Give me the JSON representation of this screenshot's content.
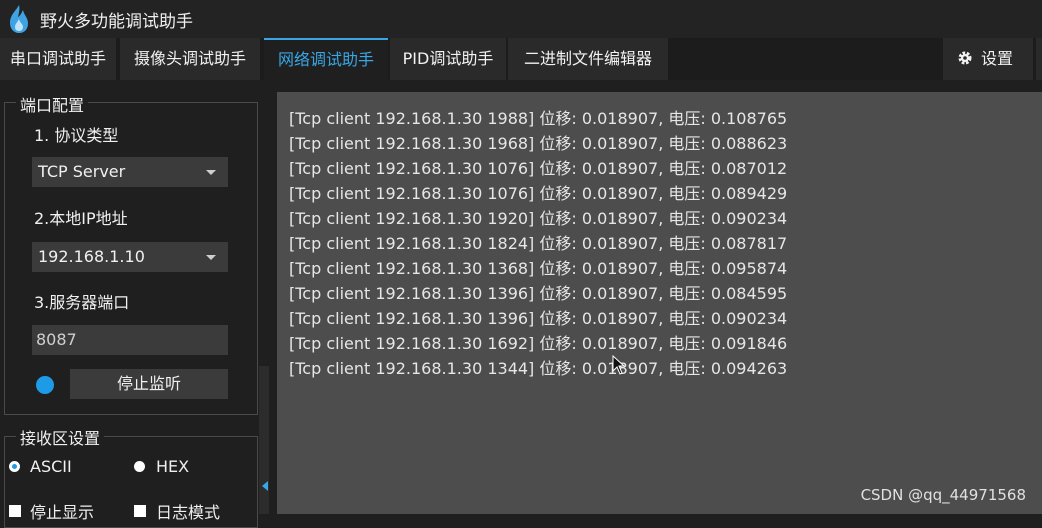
{
  "app": {
    "title": "野火多功能调试助手"
  },
  "tabs": [
    {
      "label": "串口调试助手"
    },
    {
      "label": "摄像头调试助手"
    },
    {
      "label": "网络调试助手",
      "active": true
    },
    {
      "label": "PID调试助手"
    },
    {
      "label": "二进制文件编辑器"
    }
  ],
  "settings": {
    "label": "设置"
  },
  "port_config": {
    "title": "端口配置",
    "protocol_label": "1. 协议类型",
    "protocol_value": "TCP Server",
    "local_ip_label": "2.本地IP地址",
    "local_ip_value": "192.168.1.10",
    "server_port_label": "3.服务器端口",
    "server_port_value": "8087",
    "stop_button": "停止监听"
  },
  "receive_settings": {
    "title": "接收区设置",
    "ascii_label": "ASCII",
    "hex_label": "HEX",
    "stop_display_label": "停止显示",
    "log_mode_label": "日志模式"
  },
  "log_lines": [
    "[Tcp client 192.168.1.30 1988] 位移: 0.018907, 电压: 0.108765",
    "[Tcp client 192.168.1.30 1968] 位移: 0.018907, 电压: 0.088623",
    "[Tcp client 192.168.1.30 1076] 位移: 0.018907, 电压: 0.087012",
    "[Tcp client 192.168.1.30 1076] 位移: 0.018907, 电压: 0.089429",
    "[Tcp client 192.168.1.30 1920] 位移: 0.018907, 电压: 0.090234",
    "[Tcp client 192.168.1.30 1824] 位移: 0.018907, 电压: 0.087817",
    "[Tcp client 192.168.1.30 1368] 位移: 0.018907, 电压: 0.095874",
    "[Tcp client 192.168.1.30 1396] 位移: 0.018907, 电压: 0.084595",
    "[Tcp client 192.168.1.30 1396] 位移: 0.018907, 电压: 0.090234",
    "[Tcp client 192.168.1.30 1692] 位移: 0.018907, 电压: 0.091846",
    "[Tcp client 192.168.1.30 1344] 位移: 0.018907, 电压: 0.094263"
  ],
  "watermark": "CSDN @qq_44971568",
  "colors": {
    "accent": "#39a7e6",
    "status_dot": "#1e9be6",
    "receive_bg": "#4d4d4d"
  }
}
